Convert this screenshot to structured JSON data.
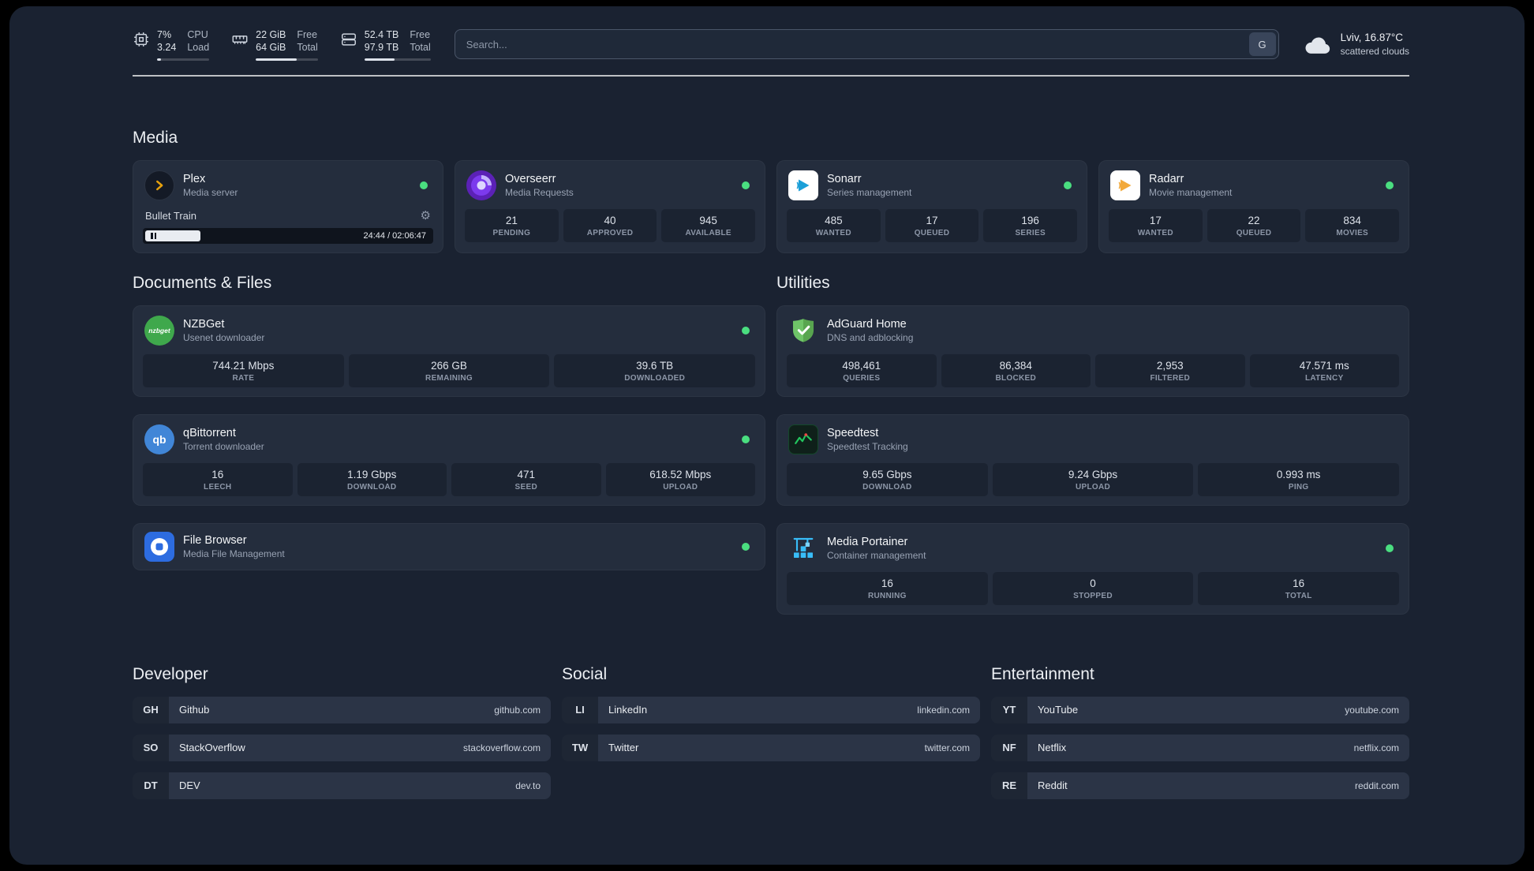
{
  "colors": {
    "status_green": "#4ade80",
    "plex_amber": "#e5a00d"
  },
  "header": {
    "resources": [
      {
        "icon": "cpu-icon",
        "value_top": "7%",
        "value_bottom": "3.24",
        "label_top": "CPU",
        "label_bottom": "Load",
        "progress": 7
      },
      {
        "icon": "memory-icon",
        "value_top": "22 GiB",
        "value_bottom": "64 GiB",
        "label_top": "Free",
        "label_bottom": "Total",
        "progress": 66
      },
      {
        "icon": "disk-icon",
        "value_top": "52.4 TB",
        "value_bottom": "97.9 TB",
        "label_top": "Free",
        "label_bottom": "Total",
        "progress": 46
      }
    ],
    "search": {
      "placeholder": "Search...",
      "button_label": "G"
    },
    "weather": {
      "location": "Lviv, 16.87°C",
      "condition": "scattered clouds"
    }
  },
  "media": {
    "title": "Media",
    "plex": {
      "name": "Plex",
      "desc": "Media server",
      "now_playing": "Bullet Train",
      "time": "24:44 / 02:06:47",
      "progress": 19
    },
    "overseerr": {
      "name": "Overseerr",
      "desc": "Media Requests",
      "stats": [
        {
          "value": "21",
          "label": "PENDING"
        },
        {
          "value": "40",
          "label": "APPROVED"
        },
        {
          "value": "945",
          "label": "AVAILABLE"
        }
      ]
    },
    "sonarr": {
      "name": "Sonarr",
      "desc": "Series management",
      "stats": [
        {
          "value": "485",
          "label": "WANTED"
        },
        {
          "value": "17",
          "label": "QUEUED"
        },
        {
          "value": "196",
          "label": "SERIES"
        }
      ]
    },
    "radarr": {
      "name": "Radarr",
      "desc": "Movie management",
      "stats": [
        {
          "value": "17",
          "label": "WANTED"
        },
        {
          "value": "22",
          "label": "QUEUED"
        },
        {
          "value": "834",
          "label": "MOVIES"
        }
      ]
    }
  },
  "documents": {
    "title": "Documents & Files",
    "nzbget": {
      "name": "NZBGet",
      "desc": "Usenet downloader",
      "icon_text": "nzbget",
      "stats": [
        {
          "value": "744.21 Mbps",
          "label": "RATE"
        },
        {
          "value": "266 GB",
          "label": "REMAINING"
        },
        {
          "value": "39.6 TB",
          "label": "DOWNLOADED"
        }
      ]
    },
    "qbittorrent": {
      "name": "qBittorrent",
      "desc": "Torrent downloader",
      "icon_text": "qb",
      "stats": [
        {
          "value": "16",
          "label": "LEECH"
        },
        {
          "value": "1.19 Gbps",
          "label": "DOWNLOAD"
        },
        {
          "value": "471",
          "label": "SEED"
        },
        {
          "value": "618.52 Mbps",
          "label": "UPLOAD"
        }
      ]
    },
    "filebrowser": {
      "name": "File Browser",
      "desc": "Media File Management"
    }
  },
  "utilities": {
    "title": "Utilities",
    "adguard": {
      "name": "AdGuard Home",
      "desc": "DNS and adblocking",
      "stats": [
        {
          "value": "498,461",
          "label": "QUERIES"
        },
        {
          "value": "86,384",
          "label": "BLOCKED"
        },
        {
          "value": "2,953",
          "label": "FILTERED"
        },
        {
          "value": "47.571 ms",
          "label": "LATENCY"
        }
      ]
    },
    "speedtest": {
      "name": "Speedtest",
      "desc": "Speedtest Tracking",
      "stats": [
        {
          "value": "9.65 Gbps",
          "label": "DOWNLOAD"
        },
        {
          "value": "9.24 Gbps",
          "label": "UPLOAD"
        },
        {
          "value": "0.993 ms",
          "label": "PING"
        }
      ]
    },
    "portainer": {
      "name": "Media Portainer",
      "desc": "Container management",
      "stats": [
        {
          "value": "16",
          "label": "RUNNING"
        },
        {
          "value": "0",
          "label": "STOPPED"
        },
        {
          "value": "16",
          "label": "TOTAL"
        }
      ]
    }
  },
  "bookmarks": [
    {
      "title": "Developer",
      "items": [
        {
          "abbr": "GH",
          "name": "Github",
          "url": "github.com"
        },
        {
          "abbr": "SO",
          "name": "StackOverflow",
          "url": "stackoverflow.com"
        },
        {
          "abbr": "DT",
          "name": "DEV",
          "url": "dev.to"
        }
      ]
    },
    {
      "title": "Social",
      "items": [
        {
          "abbr": "LI",
          "name": "LinkedIn",
          "url": "linkedin.com"
        },
        {
          "abbr": "TW",
          "name": "Twitter",
          "url": "twitter.com"
        }
      ]
    },
    {
      "title": "Entertainment",
      "items": [
        {
          "abbr": "YT",
          "name": "YouTube",
          "url": "youtube.com"
        },
        {
          "abbr": "NF",
          "name": "Netflix",
          "url": "netflix.com"
        },
        {
          "abbr": "RE",
          "name": "Reddit",
          "url": "reddit.com"
        }
      ]
    }
  ]
}
